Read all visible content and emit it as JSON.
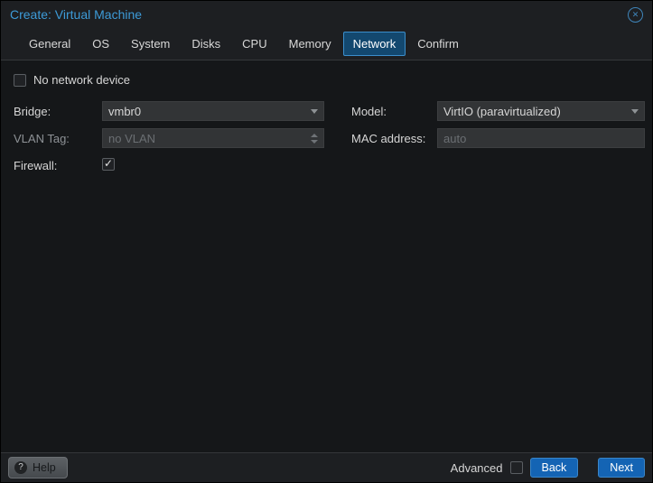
{
  "window": {
    "title": "Create: Virtual Machine"
  },
  "icons": {
    "close_glyph": "✕",
    "help_glyph": "?"
  },
  "tabs": [
    {
      "label": "General",
      "active": false
    },
    {
      "label": "OS",
      "active": false
    },
    {
      "label": "System",
      "active": false
    },
    {
      "label": "Disks",
      "active": false
    },
    {
      "label": "CPU",
      "active": false
    },
    {
      "label": "Memory",
      "active": false
    },
    {
      "label": "Network",
      "active": true
    },
    {
      "label": "Confirm",
      "active": false
    }
  ],
  "form": {
    "no_network_device": {
      "label": "No network device",
      "checked": false
    },
    "bridge": {
      "label": "Bridge:",
      "value": "vmbr0"
    },
    "vlan": {
      "label": "VLAN Tag:",
      "placeholder": "no VLAN",
      "disabled": true
    },
    "firewall": {
      "label": "Firewall:",
      "checked": true
    },
    "model": {
      "label": "Model:",
      "value": "VirtIO (paravirtualized)"
    },
    "mac": {
      "label": "MAC address:",
      "placeholder": "auto"
    }
  },
  "footer": {
    "help": "Help",
    "advanced": "Advanced",
    "advanced_checked": false,
    "back": "Back",
    "next": "Next"
  },
  "colors": {
    "title_accent": "#3d9bd8",
    "active_tab_bg": "#13486f",
    "active_tab_border": "#3b8ecb",
    "button_blue": "#1464b4",
    "field_bg": "#323436",
    "content_bg": "#151719",
    "bar_bg": "#1d1f22"
  }
}
